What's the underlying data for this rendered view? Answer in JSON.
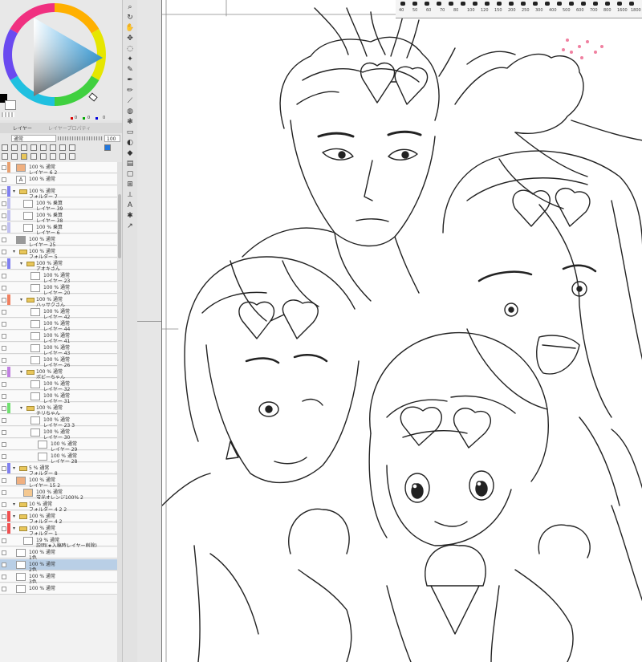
{
  "panel_tabs": {
    "layer": "レイヤー",
    "layer_property": "レイヤープロパティ"
  },
  "layer_controls": {
    "blend_mode": "通常",
    "opacity": "100"
  },
  "color": {
    "main": "#000000",
    "sub": "#ffffff"
  },
  "color_codes": [
    "0",
    "0",
    "0"
  ],
  "ruler_numbers": [
    "40",
    "50",
    "60",
    "70",
    "80",
    "100",
    "120",
    "150",
    "200",
    "250",
    "300",
    "400",
    "500",
    "600",
    "700",
    "800",
    "1600",
    "1800"
  ],
  "tool_icons": [
    "zoom-icon",
    "rotate-icon",
    "hand-icon",
    "move-icon",
    "lasso-icon",
    "magic-wand-icon",
    "eyedropper-icon",
    "pen-icon",
    "pencil-icon",
    "brush-icon",
    "airbrush-icon",
    "decoration-icon",
    "eraser-icon",
    "blend-icon",
    "fill-icon",
    "gradient-icon",
    "shape-icon",
    "frame-icon",
    "ruler-icon",
    "text-icon",
    "balloon-icon",
    "correction-icon"
  ],
  "layers": [
    {
      "blend": "100 % 通常",
      "name": "レイヤー 6 2",
      "type": "layer",
      "tag": "#e8a070",
      "indent": 0,
      "thumb": "#f0b080"
    },
    {
      "blend": "100 % 通常",
      "name": "",
      "type": "text",
      "tag": "",
      "indent": 0
    },
    {
      "blend": "100 % 通常",
      "name": "フォルダー 7",
      "type": "folder",
      "tag": "#8080f0",
      "indent": 0
    },
    {
      "blend": "100 % 乗算",
      "name": "レイヤー 39",
      "type": "layer",
      "tag": "#c0c0f0",
      "indent": 1
    },
    {
      "blend": "100 % 乗算",
      "name": "レイヤー 38",
      "type": "layer",
      "tag": "#c0c0f0",
      "indent": 1
    },
    {
      "blend": "100 % 乗算",
      "name": "レイヤー 6",
      "type": "layer",
      "tag": "#c0c0f0",
      "indent": 1
    },
    {
      "blend": "100 % 通常",
      "name": "レイヤー 25",
      "type": "layer",
      "tag": "",
      "indent": 0,
      "thumb": "#999999"
    },
    {
      "blend": "100 % 通常",
      "name": "フォルダー 5",
      "type": "folder",
      "tag": "",
      "indent": 0
    },
    {
      "blend": "100 % 通常",
      "name": "アオキさん",
      "type": "folder",
      "tag": "#8080f0",
      "indent": 1
    },
    {
      "blend": "100 % 通常",
      "name": "レイヤー 23",
      "type": "layer",
      "tag": "",
      "indent": 2
    },
    {
      "blend": "100 % 通常",
      "name": "レイヤー 20",
      "type": "layer",
      "tag": "",
      "indent": 2
    },
    {
      "blend": "100 % 通常",
      "name": "ハッサクさん",
      "type": "folder",
      "tag": "#f08060",
      "indent": 1
    },
    {
      "blend": "100 % 通常",
      "name": "レイヤー 42",
      "type": "layer",
      "tag": "",
      "indent": 2
    },
    {
      "blend": "100 % 通常",
      "name": "レイヤー 44",
      "type": "layer",
      "tag": "",
      "indent": 2
    },
    {
      "blend": "100 % 通常",
      "name": "レイヤー 41",
      "type": "layer",
      "tag": "",
      "indent": 2
    },
    {
      "blend": "100 % 通常",
      "name": "レイヤー 43",
      "type": "layer",
      "tag": "",
      "indent": 2
    },
    {
      "blend": "100 % 通常",
      "name": "レイヤー 26",
      "type": "layer",
      "tag": "",
      "indent": 2
    },
    {
      "blend": "100 % 通常",
      "name": "ポピーちゃん",
      "type": "folder",
      "tag": "#c080e0",
      "indent": 1
    },
    {
      "blend": "100 % 通常",
      "name": "レイヤー 32",
      "type": "layer",
      "tag": "",
      "indent": 2
    },
    {
      "blend": "100 % 通常",
      "name": "レイヤー 31",
      "type": "layer",
      "tag": "",
      "indent": 2
    },
    {
      "blend": "100 % 通常",
      "name": "チリちゃん",
      "type": "folder",
      "tag": "#70e070",
      "indent": 1
    },
    {
      "blend": "100 % 通常",
      "name": "レイヤー 23 3",
      "type": "layer",
      "tag": "",
      "indent": 2
    },
    {
      "blend": "100 % 通常",
      "name": "レイヤー 30",
      "type": "layer",
      "tag": "",
      "indent": 2
    },
    {
      "blend": "100 % 通常",
      "name": "レイヤー 29",
      "type": "layer",
      "tag": "",
      "indent": 3
    },
    {
      "blend": "100 % 通常",
      "name": "レイヤー 28",
      "type": "layer",
      "tag": "",
      "indent": 3
    },
    {
      "blend": "5 % 通常",
      "name": "フォルダー 8",
      "type": "folder",
      "tag": "#8080f0",
      "indent": 0
    },
    {
      "blend": "100 % 通常",
      "name": "レイヤー 15 2",
      "type": "layer",
      "tag": "",
      "indent": 0,
      "thumb": "#f0b080"
    },
    {
      "blend": "100 % 通常",
      "name": "蛍光オレンジ100% 2",
      "type": "layer",
      "tag": "",
      "indent": 1,
      "thumb": "#f4c890"
    },
    {
      "blend": "10 % 通常",
      "name": "フォルダー 4 2 2",
      "type": "folder",
      "tag": "",
      "indent": 0
    },
    {
      "blend": "100 % 通常",
      "name": "フォルダー 4 2",
      "type": "folder",
      "tag": "#f05050",
      "indent": 0
    },
    {
      "blend": "100 % 通常",
      "name": "フォルダー 1",
      "type": "folder",
      "tag": "#f05050",
      "indent": 0
    },
    {
      "blend": "19 % 通常",
      "name": "説明(★入稿時レイヤー削除)",
      "type": "layer",
      "tag": "",
      "indent": 1
    },
    {
      "blend": "100 % 通常",
      "name": "1色",
      "type": "layer",
      "tag": "",
      "indent": 0
    },
    {
      "blend": "100 % 通常",
      "name": "2色",
      "type": "layer",
      "tag": "",
      "indent": 0,
      "selected": true
    },
    {
      "blend": "100 % 通常",
      "name": "3色",
      "type": "layer",
      "tag": "",
      "indent": 0
    },
    {
      "blend": "100 % 通常",
      "name": "",
      "type": "layer",
      "tag": "",
      "indent": 0
    }
  ]
}
